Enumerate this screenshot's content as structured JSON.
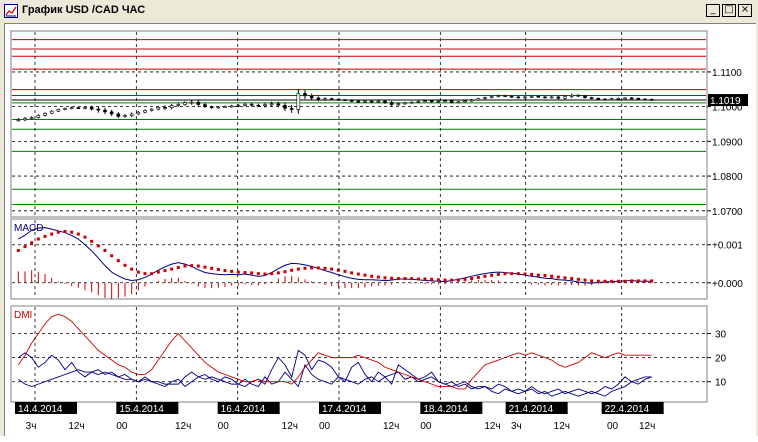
{
  "window": {
    "title": "График USD /CAD  ЧАС",
    "minimize_glyph": "_",
    "maximize_glyph": "□",
    "close_glyph": "×"
  },
  "colors": {
    "candles": "#000000",
    "resistance_lines": "#c00000",
    "support_lines": "#008000",
    "current_price_line": "#000000",
    "price_badge_bg": "#000000",
    "price_badge_text": "#ffffff",
    "macd_line": "#000080",
    "signal_line": "#cc0000",
    "histogram": "#cc0000",
    "dmi_plus": "#cc0000",
    "dmi_minus": "#000080",
    "adx": "#000080",
    "date_badge_bg": "#000000",
    "date_badge_text": "#ffffff",
    "grid": "#000000"
  },
  "icons": {
    "title_icon": "chart-icon"
  },
  "chart_data": [
    {
      "type": "line",
      "panel": "price",
      "series_kind": "candlestick",
      "y_ticks": [
        "1.1100",
        "1.1000",
        "1.0900",
        "1.0800",
        "1.0700"
      ],
      "y_tick_values": [
        1.11,
        1.1,
        1.09,
        1.08,
        1.07
      ],
      "ylim": [
        1.0685,
        1.1215
      ],
      "current_price": "1.1019",
      "current_price_value": 1.1019,
      "resistance_levels": [
        1.1193,
        1.1166,
        1.1145,
        1.1108,
        1.1049,
        1.1032
      ],
      "support_levels": [
        1.1011,
        1.0963,
        1.0935,
        1.0871,
        1.0762,
        1.0718
      ],
      "close": [
        1.0962,
        1.0966,
        1.0969,
        1.0975,
        1.0981,
        1.0987,
        1.0992,
        1.0995,
        1.0997,
        1.0996,
        1.0998,
        1.0993,
        1.099,
        1.0985,
        1.0979,
        1.0972,
        1.0974,
        1.0979,
        1.0984,
        1.0989,
        1.0993,
        1.0998,
        1.0997,
        1.1003,
        1.1006,
        1.1012,
        1.1013,
        1.1006,
        1.1,
        1.0997,
        1.0999,
        1.1,
        1.1002,
        1.1004,
        1.1007,
        1.1004,
        1.1003,
        1.1006,
        1.1008,
        1.1004,
        1.0995,
        1.0992,
        1.1038,
        1.1031,
        1.1025,
        1.102,
        1.1023,
        1.1021,
        1.102,
        1.1018,
        1.1016,
        1.1014,
        1.1016,
        1.1014,
        1.1016,
        1.1012,
        1.1006,
        1.1008,
        1.1011,
        1.1013,
        1.1015,
        1.1017,
        1.1014,
        1.1016,
        1.1017,
        1.1012,
        1.1014,
        1.1017,
        1.1019,
        1.1023,
        1.1026,
        1.1029,
        1.1032,
        1.103,
        1.1028,
        1.1026,
        1.1028,
        1.103,
        1.1028,
        1.1026,
        1.1028,
        1.1024,
        1.1029,
        1.1033,
        1.1031,
        1.1026,
        1.1024,
        1.1022,
        1.1021,
        1.1023,
        1.1024,
        1.1025,
        1.1024,
        1.1022,
        1.1021,
        1.1019
      ],
      "spread": [
        0.001,
        0.0008,
        0.0007,
        0.0006,
        0.0006,
        0.0006,
        0.0005,
        0.0005,
        0.0006,
        0.0006,
        0.0007,
        0.0009,
        0.0015,
        0.0014,
        0.0012,
        0.001,
        0.0009,
        0.0008,
        0.0007,
        0.0006,
        0.0006,
        0.0007,
        0.0012,
        0.0009,
        0.0008,
        0.0007,
        0.0013,
        0.001,
        0.0008,
        0.0006,
        0.0005,
        0.0005,
        0.0006,
        0.0007,
        0.0007,
        0.0008,
        0.0009,
        0.0012,
        0.0013,
        0.0012,
        0.0015,
        0.002,
        0.0025,
        0.0019,
        0.0013,
        0.0009,
        0.0007,
        0.0006,
        0.0005,
        0.0005,
        0.0006,
        0.0005,
        0.0006,
        0.0005,
        0.0006,
        0.0008,
        0.0009,
        0.0007,
        0.0006,
        0.0005,
        0.0006,
        0.0005,
        0.0005,
        0.0006,
        0.0006,
        0.0006,
        0.0005,
        0.0005,
        0.0006,
        0.0005,
        0.0005,
        0.0005,
        0.0006,
        0.0005,
        0.0006,
        0.0006,
        0.0006,
        0.0006,
        0.0005,
        0.0005,
        0.0005,
        0.0007,
        0.0008,
        0.0009,
        0.0006,
        0.0006,
        0.0005,
        0.0005,
        0.0005,
        0.0005,
        0.0005,
        0.0005,
        0.0005,
        0.0005,
        0.0005,
        0.0005
      ]
    },
    {
      "type": "line",
      "panel": "macd",
      "title": "MACD",
      "y_ticks": [
        "+0.001",
        "+0.000"
      ],
      "y_tick_values": [
        0.001,
        0.0
      ],
      "ylim": [
        -0.0004,
        0.00165
      ],
      "macd": [
        0.00115,
        0.00125,
        0.00138,
        0.00144,
        0.00145,
        0.00141,
        0.00136,
        0.00132,
        0.00124,
        0.00115,
        0.001,
        0.00084,
        0.00065,
        0.00045,
        0.00028,
        0.00018,
        0.0001,
        6e-05,
        8e-05,
        0.00014,
        0.00023,
        0.00033,
        0.00042,
        0.00049,
        0.00053,
        0.00049,
        0.00043,
        0.00034,
        0.00027,
        0.00024,
        0.00022,
        0.00021,
        0.00022,
        0.00021,
        0.00023,
        0.0002,
        0.00017,
        0.00019,
        0.00027,
        0.00037,
        0.00046,
        0.00051,
        0.0005,
        0.00047,
        0.00043,
        0.00038,
        0.00032,
        0.00027,
        0.00021,
        0.00016,
        0.00012,
        9e-05,
        8e-05,
        8e-05,
        7e-05,
        6e-05,
        7e-05,
        0.0001,
        0.0001,
        9e-05,
        8e-05,
        6e-05,
        5e-05,
        4e-05,
        3e-05,
        6e-05,
        9e-05,
        0.00013,
        0.00017,
        0.00021,
        0.00024,
        0.00027,
        0.00028,
        0.00027,
        0.00025,
        0.00023,
        0.0002,
        0.00017,
        0.00015,
        0.00012,
        0.00011,
        8e-05,
        7e-05,
        5e-05,
        2e-05,
        0.0,
        -1e-05,
        1e-05,
        2e-05,
        3e-05,
        4e-05,
        5e-05,
        6e-05,
        4e-05,
        4e-05,
        4e-05
      ],
      "signal": [
        0.00085,
        0.00095,
        0.00105,
        0.00115,
        0.00122,
        0.00128,
        0.00133,
        0.00135,
        0.00133,
        0.00128,
        0.0012,
        0.00109,
        0.00097,
        0.00085,
        0.00071,
        0.00058,
        0.00046,
        0.00036,
        0.00028,
        0.00024,
        0.00024,
        0.00028,
        0.00032,
        0.00036,
        0.0004,
        0.00044,
        0.00045,
        0.00044,
        0.00041,
        0.00038,
        0.00035,
        0.00032,
        0.0003,
        0.00028,
        0.00027,
        0.00026,
        0.00024,
        0.00023,
        0.00024,
        0.00026,
        0.00029,
        0.00033,
        0.00036,
        0.00038,
        0.00039,
        0.00039,
        0.00038,
        0.00036,
        0.00033,
        0.0003,
        0.00026,
        0.00023,
        0.0002,
        0.00017,
        0.00015,
        0.00013,
        0.00012,
        0.00011,
        0.00011,
        0.00011,
        0.0001,
        0.0001,
        9e-05,
        8e-05,
        7e-05,
        7e-05,
        7e-05,
        9e-05,
        0.00011,
        0.00014,
        0.00017,
        0.0002,
        0.00022,
        0.00024,
        0.00024,
        0.00024,
        0.00023,
        0.00022,
        0.0002,
        0.00019,
        0.00017,
        0.00015,
        0.00013,
        0.00011,
        9e-05,
        7e-05,
        5e-05,
        4e-05,
        4e-05,
        4e-05,
        4e-05,
        4e-05,
        5e-05,
        5e-05,
        5e-05,
        5e-05
      ],
      "histogram": [
        0.0003,
        0.0003,
        0.00033,
        0.00029,
        0.00023,
        0.00013,
        3e-05,
        -3e-05,
        -9e-05,
        -0.00013,
        -0.0002,
        -0.00025,
        -0.00032,
        -0.0004,
        -0.00043,
        -0.0004,
        -0.00036,
        -0.0003,
        -0.0002,
        -0.0001,
        -1e-05,
        5e-05,
        0.0001,
        0.00013,
        0.00013,
        5e-05,
        -2e-05,
        -0.0001,
        -0.00014,
        -0.00014,
        -0.00013,
        -0.00011,
        -8e-05,
        -7e-05,
        -4e-05,
        -6e-05,
        -7e-05,
        -4e-05,
        3e-05,
        0.00011,
        0.00017,
        0.00018,
        0.00014,
        9e-05,
        4e-05,
        -1e-05,
        -6e-05,
        -9e-05,
        -0.00012,
        -0.00014,
        -0.00014,
        -0.00014,
        -0.00012,
        -9e-05,
        -8e-05,
        -7e-05,
        -5e-05,
        -1e-05,
        -1e-05,
        -2e-05,
        -2e-05,
        -4e-05,
        -4e-05,
        -4e-05,
        -4e-05,
        -1e-05,
        2e-05,
        4e-05,
        6e-05,
        7e-05,
        7e-05,
        7e-05,
        6e-05,
        3e-05,
        1e-05,
        -1e-05,
        -3e-05,
        -5e-05,
        -5e-05,
        -7e-05,
        -6e-05,
        -7e-05,
        -6e-05,
        -6e-05,
        -7e-05,
        -7e-05,
        -6e-05,
        -3e-05,
        -2e-05,
        -1e-05,
        0.0,
        1e-05,
        1e-05,
        -1e-05,
        -1e-05,
        -1e-05
      ]
    },
    {
      "type": "line",
      "panel": "dmi",
      "title": "DMI",
      "y_ticks": [
        "30",
        "20",
        "10"
      ],
      "y_tick_values": [
        30,
        20,
        10
      ],
      "ylim": [
        2,
        41
      ],
      "plus_di": [
        17,
        21,
        26,
        30,
        34,
        37,
        38,
        37,
        35,
        32,
        29,
        26,
        23,
        21,
        19,
        17,
        16,
        14,
        13,
        13,
        15,
        19,
        23,
        27,
        30,
        27,
        24,
        21,
        18,
        16,
        14,
        13,
        12,
        11,
        10,
        10,
        11,
        10,
        10,
        10,
        10,
        9,
        12,
        16,
        19,
        22,
        21,
        20,
        20,
        20,
        20,
        21,
        20,
        19,
        18,
        16,
        15,
        14,
        13,
        12,
        11,
        10,
        9,
        8,
        8,
        8,
        7,
        7,
        11,
        14,
        17,
        18,
        19,
        20,
        21,
        22,
        21,
        22,
        21,
        20,
        19,
        17,
        16,
        17,
        18,
        20,
        22,
        21,
        20,
        21,
        22,
        21,
        21,
        21,
        21,
        21
      ],
      "minus_di": [
        20,
        22,
        20,
        16,
        18,
        21,
        19,
        15,
        18,
        14,
        12,
        14,
        15,
        13,
        14,
        12,
        13,
        11,
        10,
        12,
        10,
        9,
        8,
        10,
        11,
        8,
        10,
        12,
        13,
        11,
        10,
        12,
        11,
        9,
        8,
        10,
        11,
        9,
        15,
        20,
        17,
        12,
        23,
        21,
        15,
        19,
        18,
        16,
        12,
        10,
        16,
        18,
        13,
        10,
        14,
        12,
        9,
        17,
        15,
        13,
        11,
        12,
        14,
        10,
        9,
        10,
        8,
        9,
        7,
        8,
        8,
        7,
        9,
        8,
        6,
        7,
        6,
        8,
        6,
        5,
        6,
        7,
        5,
        6,
        7,
        6,
        5,
        6,
        8,
        7,
        9,
        12,
        10,
        9,
        11,
        12
      ],
      "adx": [
        11,
        9,
        8,
        9,
        10,
        11,
        12,
        13,
        14,
        15,
        14,
        14,
        13,
        14,
        13,
        12,
        11,
        11,
        10,
        11,
        10,
        10,
        9,
        9,
        9,
        12,
        14,
        12,
        11,
        12,
        11,
        10,
        9,
        9,
        11,
        9,
        8,
        12,
        9,
        10,
        14,
        11,
        8,
        17,
        13,
        11,
        10,
        9,
        12,
        11,
        10,
        9,
        11,
        12,
        10,
        12,
        13,
        14,
        11,
        12,
        10,
        11,
        12,
        10,
        9,
        8,
        9,
        10,
        8,
        7,
        8,
        6,
        5,
        7,
        6,
        5,
        6,
        7,
        5,
        6,
        4,
        5,
        6,
        5,
        4,
        5,
        6,
        5,
        4,
        6,
        7,
        8,
        10,
        11,
        12,
        12
      ]
    }
  ],
  "x_axis": {
    "dates": [
      {
        "label": "14.4.2014",
        "index": 0
      },
      {
        "label": "15.4.2014",
        "index": 19
      },
      {
        "label": "16.4.2014",
        "index": 38
      },
      {
        "label": "17.4.2014",
        "index": 57
      },
      {
        "label": "18.4.2014",
        "index": 76
      },
      {
        "label": "21.4.2014",
        "index": 92
      },
      {
        "label": "22.4.2014",
        "index": 110
      }
    ],
    "hour_ticks": [
      {
        "label": "3ч",
        "index": 2
      },
      {
        "label": "12ч",
        "index": 10
      },
      {
        "label": "00",
        "index": 19
      },
      {
        "label": "12ч",
        "index": 30
      },
      {
        "label": "00",
        "index": 38
      },
      {
        "label": "12ч",
        "index": 50
      },
      {
        "label": "00",
        "index": 57
      },
      {
        "label": "12ч",
        "index": 69
      },
      {
        "label": "00",
        "index": 76
      },
      {
        "label": "12ч",
        "index": 88
      },
      {
        "label": "3ч",
        "index": 93
      },
      {
        "label": "12ч",
        "index": 101
      },
      {
        "label": "00",
        "index": 111
      },
      {
        "label": "12ч",
        "index": 117
      }
    ]
  }
}
